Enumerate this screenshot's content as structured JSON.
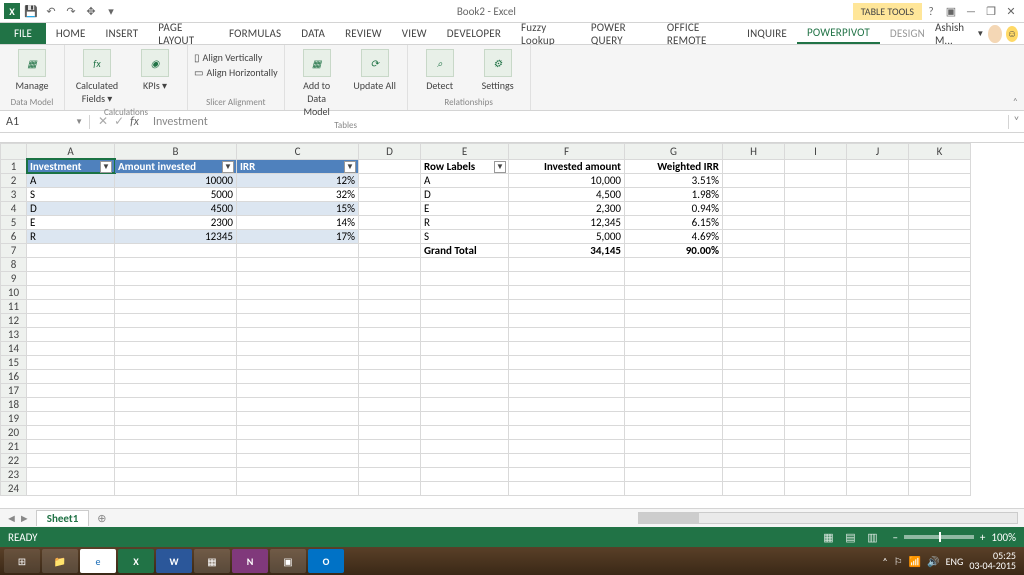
{
  "titlebar": {
    "title": "Book2 - Excel",
    "tableTools": "TABLE TOOLS"
  },
  "ribbonTabs": {
    "file": "FILE",
    "tabs": [
      "HOME",
      "INSERT",
      "PAGE LAYOUT",
      "FORMULAS",
      "DATA",
      "REVIEW",
      "VIEW",
      "DEVELOPER",
      "Fuzzy Lookup",
      "POWER QUERY",
      "OFFICE REMOTE",
      "INQUIRE",
      "POWERPIVOT",
      "DESIGN"
    ],
    "active": "POWERPIVOT",
    "user": "Ashish M..."
  },
  "ribbon": {
    "manage": "Manage",
    "calcFields": "Calculated Fields ▾",
    "kpis": "KPIs ▾",
    "alignV": "Align Vertically",
    "alignH": "Align Horizontally",
    "addToModel": "Add to Data Model",
    "updateAll": "Update All",
    "detect": "Detect",
    "settings": "Settings",
    "groups": {
      "dataModel": "Data Model",
      "calculations": "Calculations",
      "slicer": "Slicer Alignment",
      "tables": "Tables",
      "relationships": "Relationships"
    }
  },
  "formulaBar": {
    "cellRef": "A1",
    "value": "Investment"
  },
  "columns": [
    "A",
    "B",
    "C",
    "D",
    "E",
    "F",
    "G",
    "H",
    "I",
    "J",
    "K"
  ],
  "table1": {
    "headers": [
      "Investment",
      "Amount invested",
      "IRR"
    ],
    "rows": [
      {
        "inv": "A",
        "amt": "10000",
        "irr": "12%"
      },
      {
        "inv": "S",
        "amt": "5000",
        "irr": "32%"
      },
      {
        "inv": "D",
        "amt": "4500",
        "irr": "15%"
      },
      {
        "inv": "E",
        "amt": "2300",
        "irr": "14%"
      },
      {
        "inv": "R",
        "amt": "12345",
        "irr": "17%"
      }
    ]
  },
  "pivot": {
    "headers": [
      "Row Labels",
      "Invested amount",
      "Weighted IRR"
    ],
    "rows": [
      {
        "lbl": "A",
        "amt": "10,000",
        "wirr": "3.51%"
      },
      {
        "lbl": "D",
        "amt": "4,500",
        "wirr": "1.98%"
      },
      {
        "lbl": "E",
        "amt": "2,300",
        "wirr": "0.94%"
      },
      {
        "lbl": "R",
        "amt": "12,345",
        "wirr": "6.15%"
      },
      {
        "lbl": "S",
        "amt": "5,000",
        "wirr": "4.69%"
      }
    ],
    "totalLabel": "Grand Total",
    "totalAmt": "34,145",
    "totalWirr": "90.00%"
  },
  "sheet": {
    "name": "Sheet1"
  },
  "status": {
    "ready": "READY",
    "zoom": "100%"
  },
  "taskbar": {
    "lang": "ENG",
    "time": "05:25",
    "date": "03-04-2015"
  }
}
